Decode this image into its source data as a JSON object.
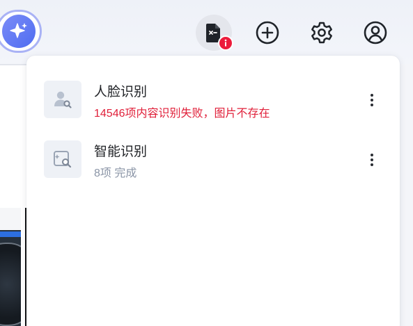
{
  "toolbar": {
    "buttons": [
      {
        "name": "ai-assistant",
        "icon": "sparkle-icon"
      },
      {
        "name": "tasks",
        "icon": "file-info-icon",
        "badge": "i"
      },
      {
        "name": "add",
        "icon": "plus-circle-icon"
      },
      {
        "name": "settings",
        "icon": "gear-icon"
      },
      {
        "name": "account",
        "icon": "user-circle-icon"
      }
    ],
    "accent_color": "#5b72f2",
    "badge_color": "#ec1c3c"
  },
  "task_panel": {
    "items": [
      {
        "title": "人脸识别",
        "status": "14546项内容识别失败，图片不存在",
        "status_type": "error",
        "icon": "face-search-icon"
      },
      {
        "title": "智能识别",
        "status": "8项 完成",
        "status_type": "done",
        "icon": "image-search-icon"
      }
    ],
    "error_color": "#e0203a",
    "done_color": "#8a94a6"
  }
}
